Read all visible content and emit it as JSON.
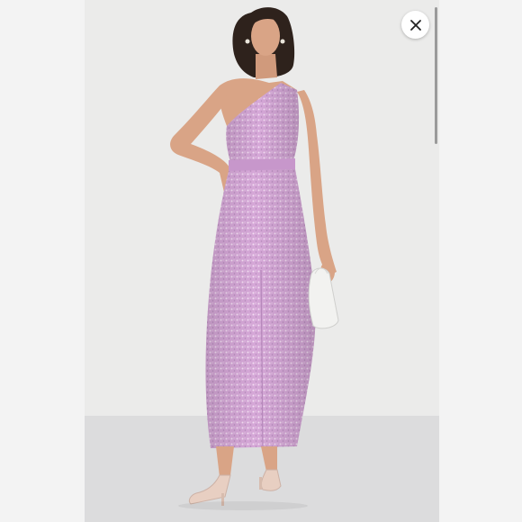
{
  "viewer": {
    "photo_alt": "",
    "close_icon": "close-icon"
  },
  "colors": {
    "backdrop": "#ebebea",
    "floor": "#dcdcdd",
    "dress": "#d6a8d8",
    "dress_shadow": "#b688bb",
    "skin": "#d9a486",
    "hair": "#2e221c",
    "clutch": "#f2f2f0",
    "heels": "#e8cfc2",
    "side_panel": "#f3f3f3"
  }
}
